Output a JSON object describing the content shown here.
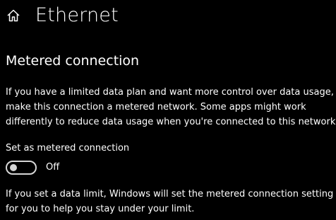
{
  "header": {
    "home_icon": "home-icon",
    "title": "Ethernet"
  },
  "metered": {
    "section_title": "Metered connection",
    "description_lines": [
      "If you have a limited data plan and want more control over data usage,",
      "make this connection a metered network. Some apps might work",
      "differently to reduce data usage when you're connected to this network."
    ],
    "toggle_label": "Set as metered connection",
    "toggle_state": "Off",
    "toggle_on": false,
    "footer_lines": [
      "If you set a data limit, Windows will set the metered connection setting",
      "for you to help you stay under your limit."
    ]
  },
  "colors": {
    "background": "#000000",
    "text": "#ffffff",
    "toggle_off": "#d6d6d6"
  }
}
